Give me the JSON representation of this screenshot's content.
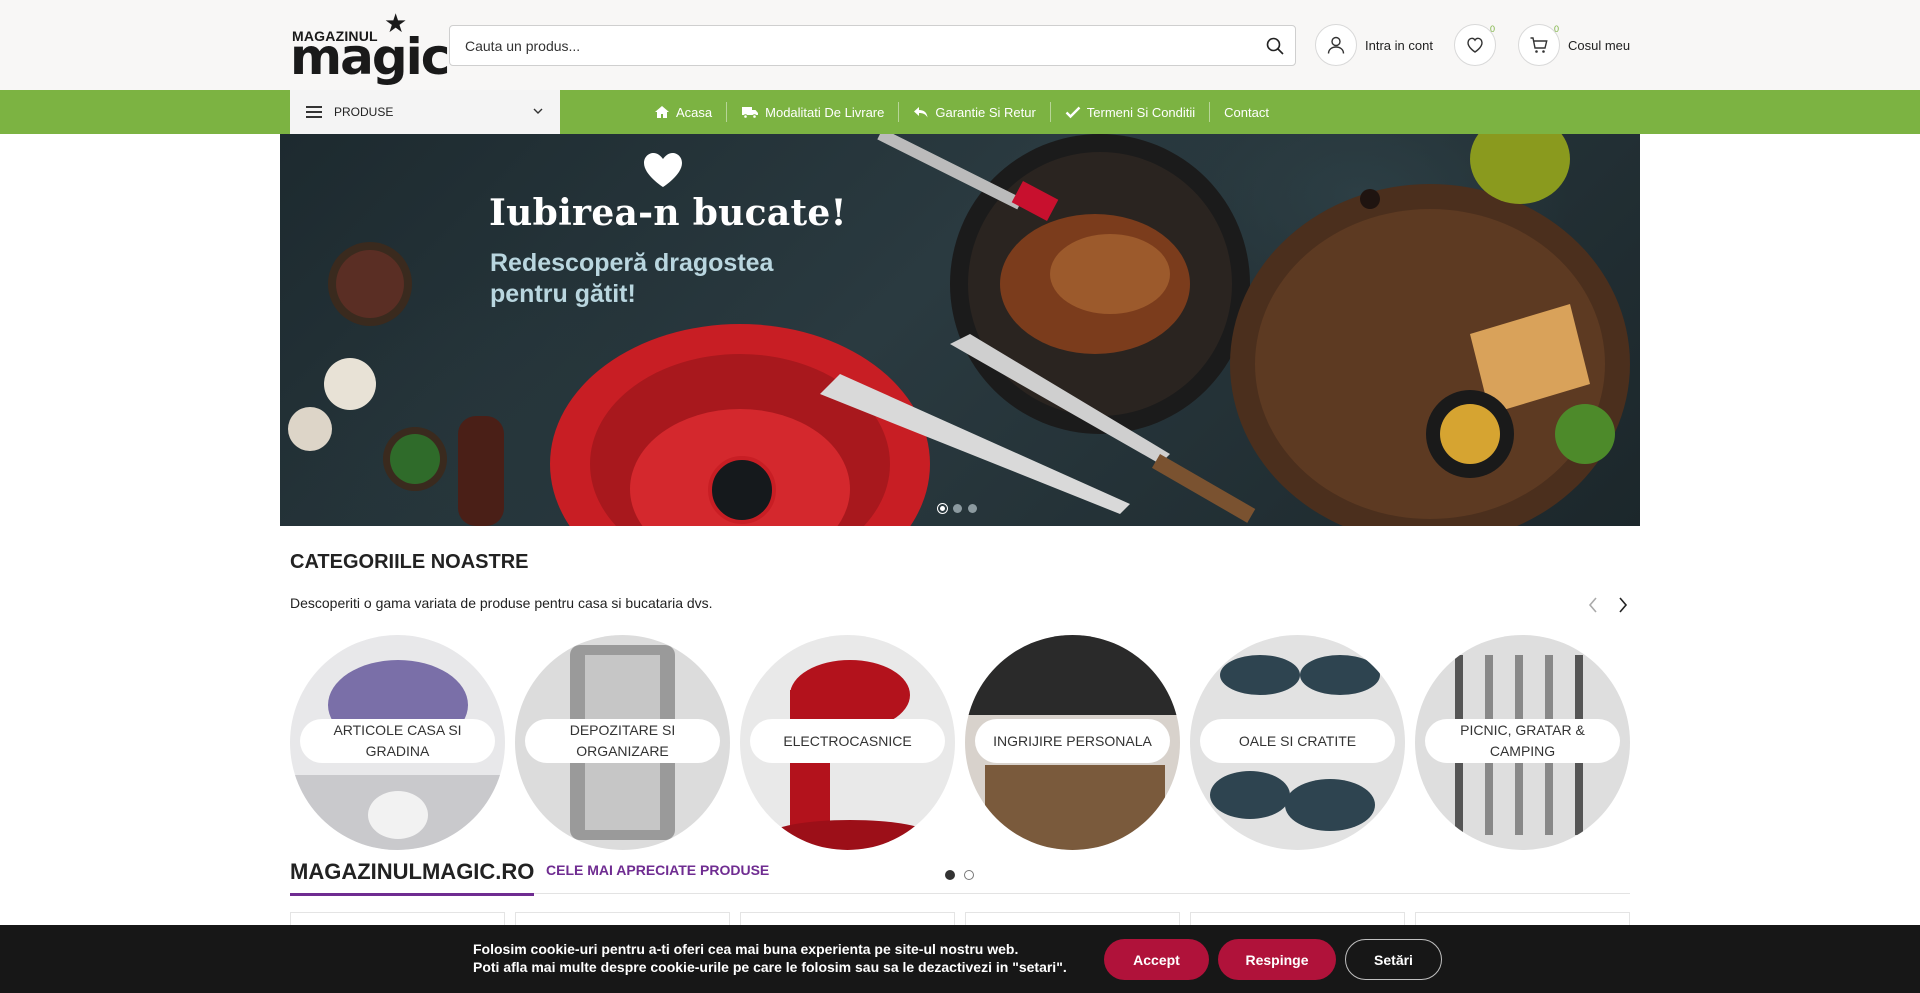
{
  "header": {
    "logo": {
      "top": "MAGAZINUL",
      "main": "magic"
    },
    "search": {
      "placeholder": "Cauta un produs..."
    },
    "account_label": "Intra in cont",
    "wishlist_count": "0",
    "cart_count": "0",
    "cart_label": "Cosul meu"
  },
  "nav": {
    "products_label": "PRODUSE",
    "items": [
      {
        "label": "Acasa",
        "icon": "home-icon"
      },
      {
        "label": "Modalitati De Livrare",
        "icon": "truck-icon"
      },
      {
        "label": "Garantie Si Retur",
        "icon": "reply-icon"
      },
      {
        "label": "Termeni Si Conditii",
        "icon": "check-icon"
      },
      {
        "label": "Contact",
        "icon": ""
      }
    ]
  },
  "hero": {
    "title": "Iubirea-n bucate!",
    "subtitle": "Redescoperă dragostea pentru gătit!",
    "slides": 3,
    "active_slide": 1
  },
  "categories": {
    "title": "CATEGORIILE NOASTRE",
    "description": "Descoperiti o gama variata de produse pentru casa si bucataria dvs.",
    "items": [
      {
        "label": "ARTICOLE CASA SI GRADINA"
      },
      {
        "label": "DEPOZITARE SI ORGANIZARE"
      },
      {
        "label": "ELECTROCASNICE"
      },
      {
        "label": "INGRIJIRE PERSONALA"
      },
      {
        "label": "OALE SI CRATITE"
      },
      {
        "label": "PICNIC, GRATAR & CAMPING"
      }
    ],
    "pages": 2,
    "active_page": 1
  },
  "tabs": {
    "main": "MAGAZINULMAGIC.RO",
    "sub": "CELE MAI APRECIATE PRODUSE"
  },
  "cookie": {
    "line1": "Folosim cookie-uri pentru a-ti oferi cea mai buna experienta pe site-ul nostru web.",
    "line2": "Poti afla mai multe despre cookie-urile pe care le folosim sau sa le dezactivezi in \"setari\".",
    "accept": "Accept",
    "reject": "Respinge",
    "settings": "Setări"
  },
  "colors": {
    "green": "#7cb342",
    "purple": "#6f2c91",
    "cookie_red": "#b0123a"
  }
}
